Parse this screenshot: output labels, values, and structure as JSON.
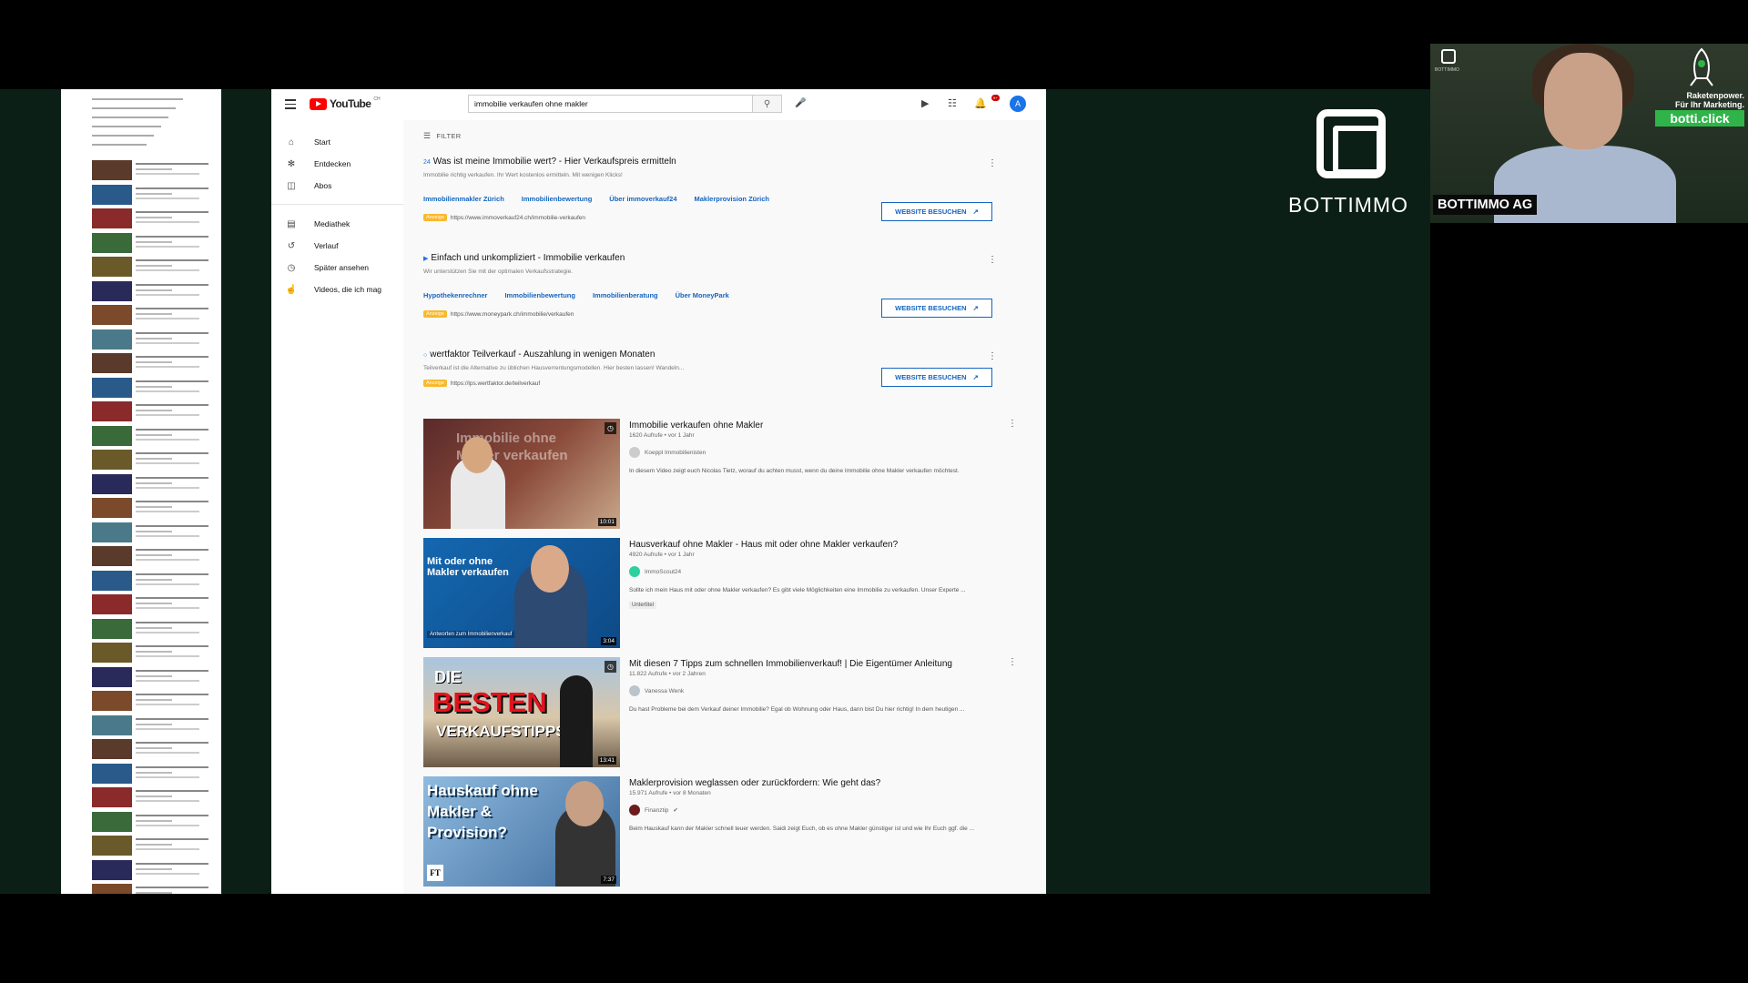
{
  "youtube": {
    "logo": "YouTube",
    "logo_suffix": "CH",
    "search_value": "immobilie verkaufen ohne makler",
    "avatar_letter": "A",
    "notification_count": "9+",
    "sidebar": [
      {
        "label": "Start",
        "icon": "home-icon"
      },
      {
        "label": "Entdecken",
        "icon": "compass-icon"
      },
      {
        "label": "Abos",
        "icon": "subscriptions-icon"
      },
      {
        "label": "Mediathek",
        "icon": "library-icon"
      },
      {
        "label": "Verlauf",
        "icon": "history-icon"
      },
      {
        "label": "Später ansehen",
        "icon": "clock-icon"
      },
      {
        "label": "Videos, die ich mag",
        "icon": "thumbs-up-icon"
      }
    ],
    "filter_label": "FILTER",
    "ads": [
      {
        "title": "Was ist meine Immobilie wert? - Hier Verkaufspreis ermitteln",
        "desc": "Immobilie richtig verkaufen. Ihr Wert kostenlos ermitteln. Mit wenigen Klicks!",
        "links": [
          "Immobilienmakler Zürich",
          "Immobilienbewertung",
          "Über immoverkauf24",
          "Maklerprovision Zürich"
        ],
        "badge": "Anzeige",
        "url": "https://www.immoverkauf24.ch/immobilie-verkaufen",
        "button": "WEBSITE BESUCHEN"
      },
      {
        "title": "Einfach und unkompliziert - Immobilie verkaufen",
        "desc": "Wir unterstützen Sie mit der optimalen Verkaufsstrategie.",
        "links": [
          "Hypothekenrechner",
          "Immobilienbewertung",
          "Immobilienberatung",
          "Über MoneyPark"
        ],
        "badge": "Anzeige",
        "url": "https://www.moneypark.ch/immobilie/verkaufen",
        "button": "WEBSITE BESUCHEN"
      },
      {
        "title": "wertfaktor Teilverkauf - Auszahlung in wenigen Monaten",
        "desc": "Teilverkauf ist die Alternative zu üblichen Hausverrentungsmodellen. Hier besten lassen! Wandeln...",
        "badge": "Anzeige",
        "url": "https://lps.wertfaktor.de/teilverkauf",
        "button": "WEBSITE BESUCHEN"
      }
    ],
    "videos": [
      {
        "title": "Immobilie verkaufen ohne Makler",
        "meta": "1620 Aufrufe • vor 1 Jahr",
        "channel": "Koeppl Immobilienisten",
        "desc": "In diesem Video zeigt euch Nicolas Tietz, worauf du achten musst, wenn du deine Immobilie ohne Makler verkaufen möchtest.",
        "thumb_text": "Immobilie ohne Makler verkaufen",
        "duration": "10:01"
      },
      {
        "title": "Hausverkauf ohne Makler - Haus mit oder ohne Makler verkaufen?",
        "meta": "4920 Aufrufe • vor 1 Jahr",
        "channel": "ImmoScout24",
        "desc": "Sollte ich mein Haus mit oder ohne Makler verkaufen? Es gibt viele Möglichkeiten eine Immobilie zu verkaufen. Unser Experte ...",
        "tag": "Untertitel",
        "thumb_text": "Mit oder ohne Makler verkaufen",
        "thumb_sub": "Antworten zum Immobilienverkauf",
        "duration": "3:04"
      },
      {
        "title": "Mit diesen 7 Tipps zum schnellen Immobilienverkauf! | Die Eigentümer Anleitung",
        "meta": "11.822 Aufrufe • vor 2 Jahren",
        "channel": "Vanessa Wenk",
        "desc": "Du hast Probleme bei dem Verkauf deiner Immobilie? Egal ob Wohnung oder Haus, dann bist Du hier richtig! In dem heutigen ...",
        "thumb_text_1": "DIE",
        "thumb_text_2": "BESTEN",
        "thumb_text_3": "VERKAUFSTIPPS",
        "duration": "13:41"
      },
      {
        "title": "Maklerprovision weglassen oder zurückfordern: Wie geht das?",
        "meta": "15.971 Aufrufe • vor 8 Monaten",
        "channel": "Finanztip",
        "desc": "Beim Hauskauf kann der Makler schnell teuer werden. Saidi zeigt Euch, ob es ohne Makler günstiger ist und wie Ihr Euch ggf. die ...",
        "thumb_text": "Hauskauf ohne Makler & Provision?",
        "thumb_logo": "FT",
        "duration": "7:37"
      }
    ]
  },
  "branding": {
    "company_word": "BOTTIMMO",
    "cam_label": "BOTTIMMO AG",
    "cam_minitext": "BOTTIMMO",
    "slogan_1": "Raketenpower.",
    "slogan_2": "Für Ihr Marketing.",
    "site": "botti.click"
  },
  "colors": {
    "youtube_red": "#ff0000",
    "link_blue": "#1565c0",
    "ad_badge": "#fbb829",
    "background_green": "#0b1f17",
    "botti_green": "#2fb44a"
  }
}
